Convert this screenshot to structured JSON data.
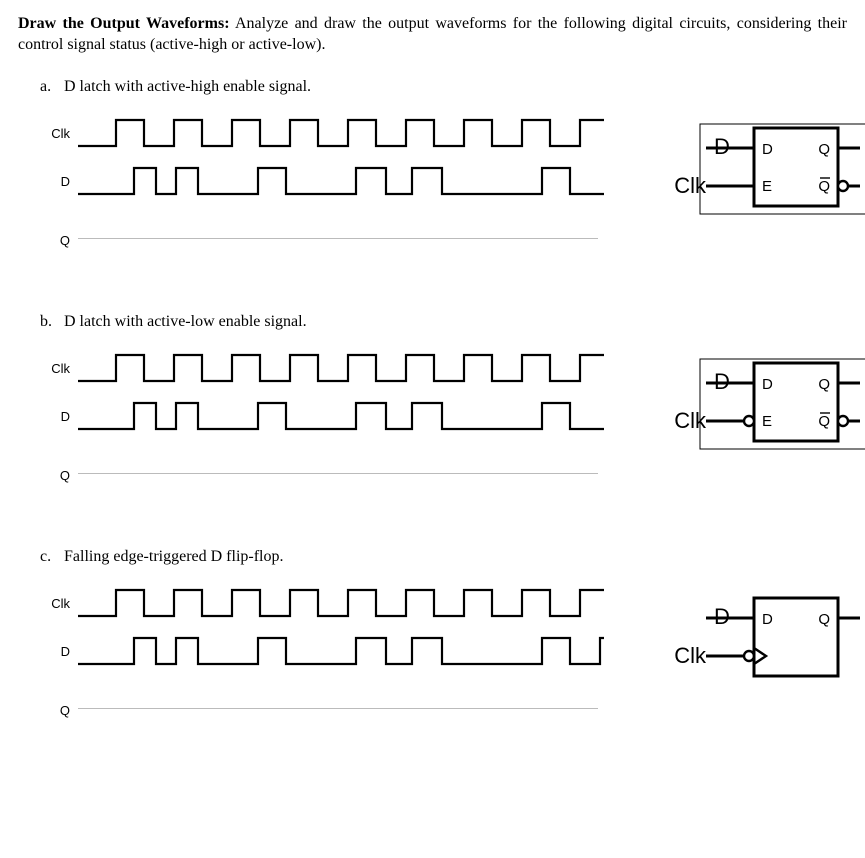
{
  "heading": {
    "bold": "Draw the Output Waveforms:",
    "rest": " Analyze and draw the output waveforms for the following digital circuits, considering their control signal status (active-high or active-low)."
  },
  "problems": [
    {
      "letter": "a.",
      "desc": "D latch with active-high enable signal."
    },
    {
      "letter": "b.",
      "desc": "D latch with active-low enable signal."
    },
    {
      "letter": "c.",
      "desc": "Falling edge-triggered D flip-flop."
    }
  ],
  "labels": {
    "clk": "Clk",
    "d": "D",
    "q": "Q",
    "e": "E",
    "sch_d": "D",
    "sch_clk": "Clk",
    "pin_d": "D",
    "pin_q": "Q",
    "pin_e": "E",
    "pin_qb": "Q"
  },
  "waveforms": {
    "clk": [
      0,
      1,
      0,
      1,
      0,
      1,
      0,
      1,
      0,
      1,
      0,
      1,
      0,
      1,
      0,
      1,
      0,
      1,
      0
    ],
    "widths_clk": [
      38,
      28,
      30,
      28,
      30,
      28,
      30,
      28,
      30,
      28,
      30,
      28,
      30,
      28,
      30,
      28,
      30,
      28,
      10
    ],
    "d_ab": [
      0,
      1,
      0,
      1,
      0,
      1,
      0,
      0,
      1,
      0,
      1,
      0,
      0,
      1,
      0,
      0
    ],
    "widths_d_ab": [
      56,
      22,
      20,
      22,
      60,
      28,
      30,
      40,
      30,
      26,
      30,
      60,
      40,
      28,
      30,
      18
    ],
    "d_c": [
      0,
      1,
      0,
      1,
      0,
      1,
      0,
      0,
      1,
      0,
      1,
      0,
      0,
      1,
      0,
      1
    ],
    "widths_d_c": [
      56,
      22,
      20,
      22,
      60,
      28,
      30,
      40,
      30,
      26,
      30,
      60,
      40,
      28,
      30,
      18
    ]
  }
}
